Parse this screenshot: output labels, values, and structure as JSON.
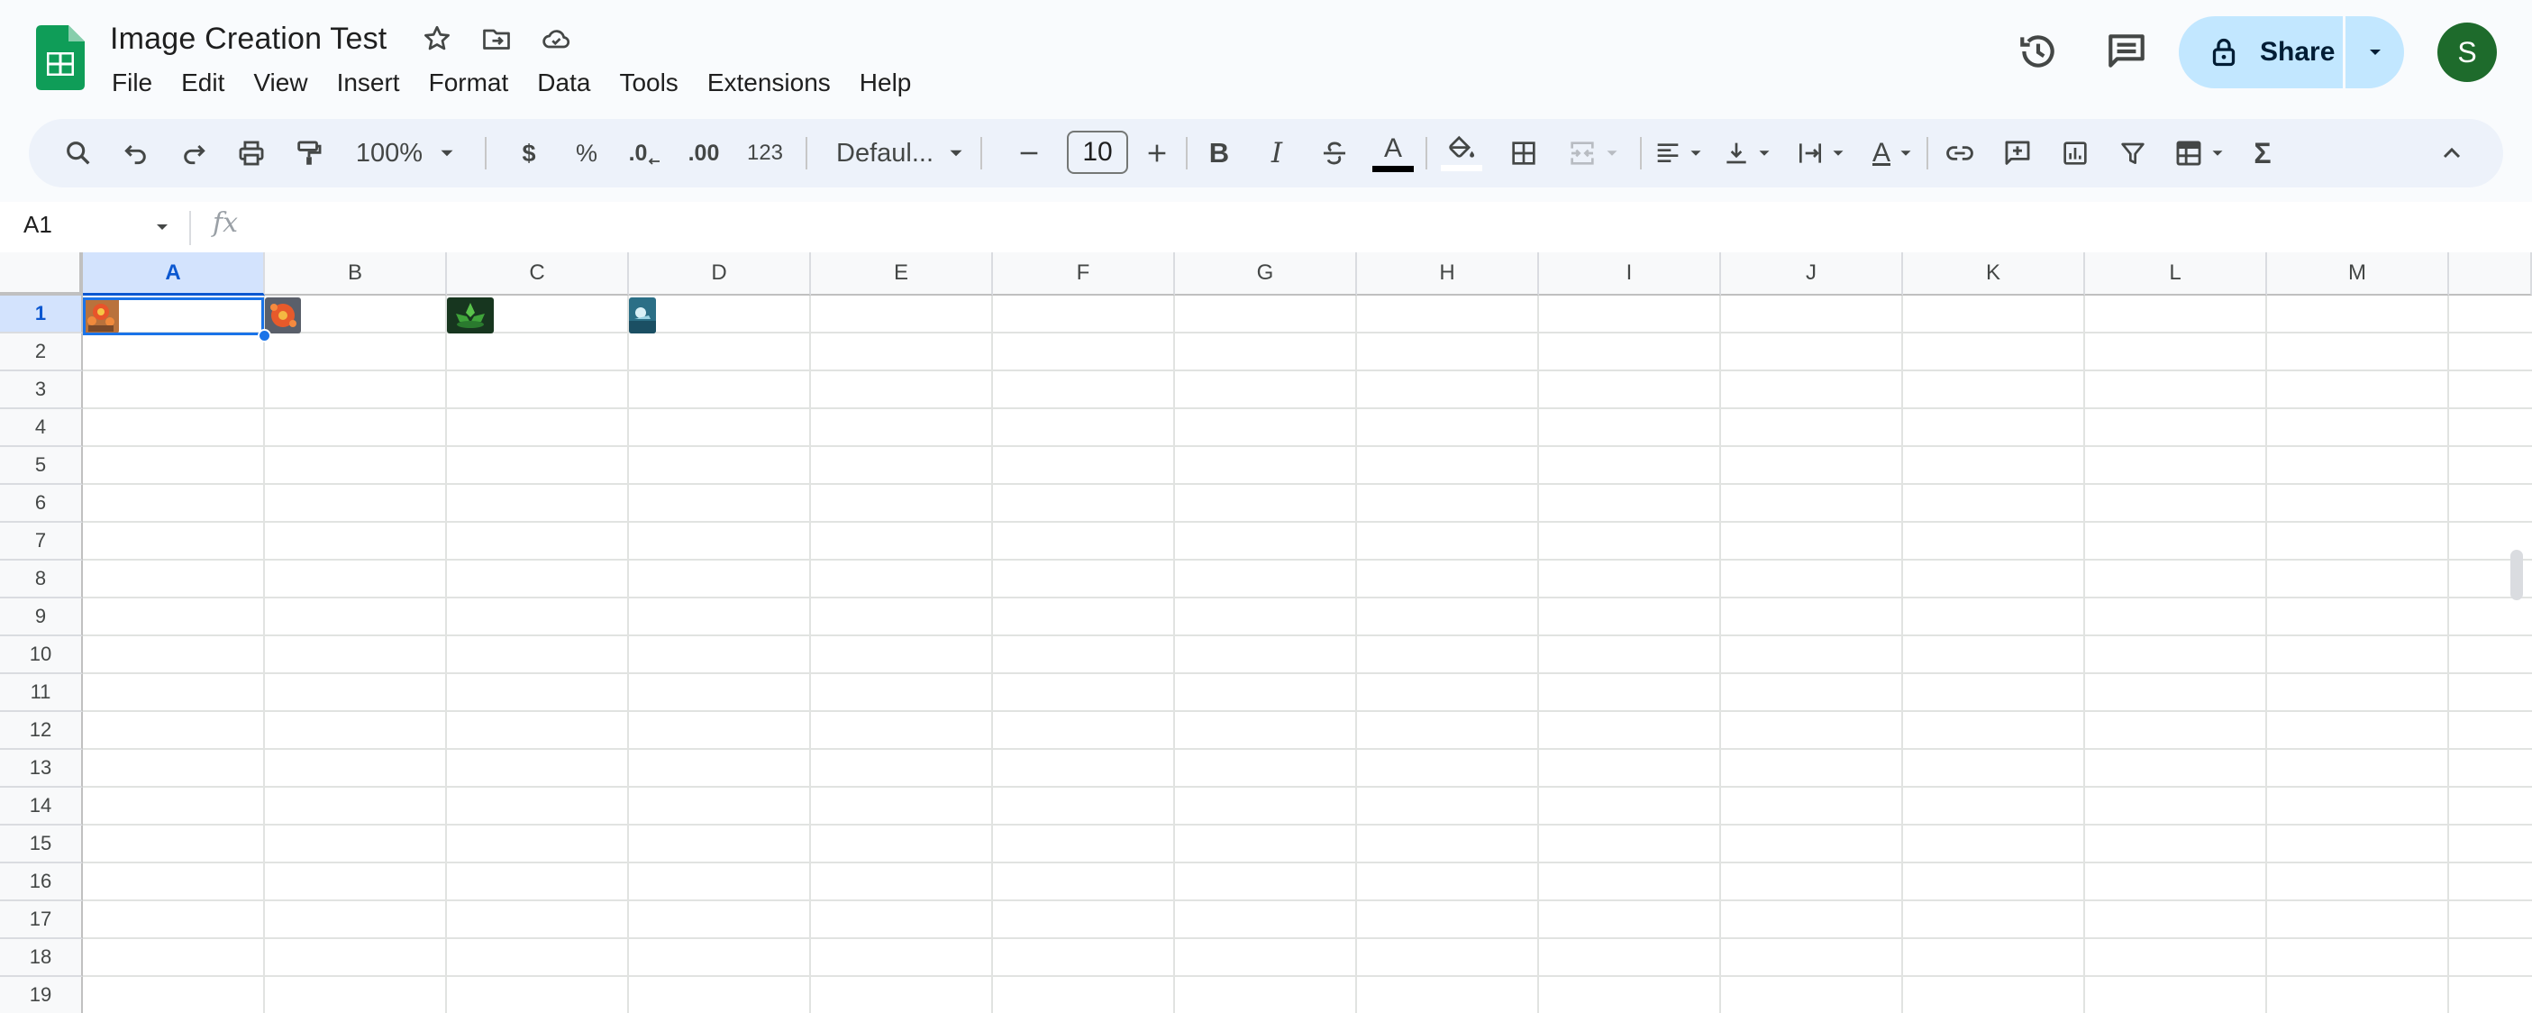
{
  "document": {
    "title": "Image Creation Test",
    "menus": [
      "File",
      "Edit",
      "View",
      "Insert",
      "Format",
      "Data",
      "Tools",
      "Extensions",
      "Help"
    ]
  },
  "header": {
    "share_label": "Share",
    "avatar_initial": "S"
  },
  "toolbar": {
    "zoom": "100%",
    "currency_symbol": "$",
    "percent_symbol": "%",
    "decrease_decimal": ".0",
    "increase_decimal": ".00",
    "number_format": "123",
    "font": "Defaul...",
    "font_size": "10",
    "bold": "B",
    "italic": "I",
    "text_color_letter": "A",
    "text_rotation_letter": "A",
    "functions_symbol": "Σ"
  },
  "formula_bar": {
    "cell_ref": "A1",
    "fx_label": "fx"
  },
  "grid": {
    "columns": [
      "A",
      "B",
      "C",
      "D",
      "E",
      "F",
      "G",
      "H",
      "I",
      "J",
      "K",
      "L",
      "M"
    ],
    "rows": [
      "1",
      "2",
      "3",
      "4",
      "5",
      "6",
      "7",
      "8",
      "9",
      "10",
      "11",
      "12",
      "13",
      "14",
      "15",
      "16",
      "17",
      "18",
      "19"
    ],
    "selected_cell": "A1"
  },
  "colors": {
    "share_bg": "#c2e7ff",
    "selection": "#1a73e8",
    "avatar_bg": "#1e6b2c"
  }
}
